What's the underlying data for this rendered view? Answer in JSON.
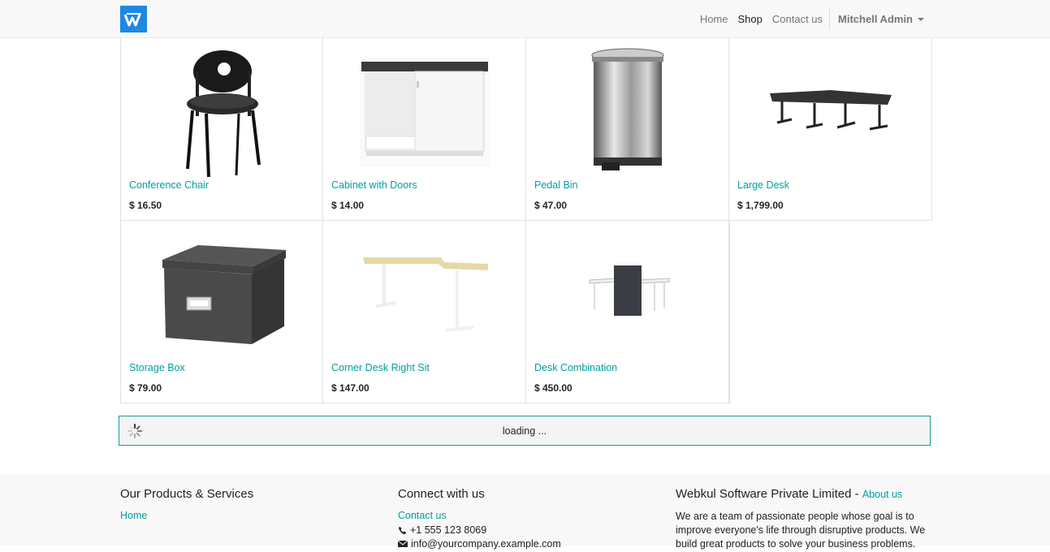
{
  "nav": {
    "links": [
      "Home",
      "Shop",
      "Contact us"
    ],
    "active": "Shop",
    "user": "Mitchell Admin"
  },
  "products": [
    {
      "name": "Conference Chair",
      "price": "$ 16.50",
      "icon": "chair-image"
    },
    {
      "name": "Cabinet with Doors",
      "price": "$ 14.00",
      "icon": "cabinet-image"
    },
    {
      "name": "Pedal Bin",
      "price": "$ 47.00",
      "icon": "bin-image"
    },
    {
      "name": "Large Desk",
      "price": "$ 1,799.00",
      "icon": "desk-image"
    },
    {
      "name": "Storage Box",
      "price": "$ 79.00",
      "icon": "box-image"
    },
    {
      "name": "Corner Desk Right Sit",
      "price": "$ 147.00",
      "icon": "corner-desk-image"
    },
    {
      "name": "Desk Combination",
      "price": "$ 450.00",
      "icon": "desk-combination-image"
    }
  ],
  "loading": {
    "text": "loading ..."
  },
  "footer": {
    "col1": {
      "title": "Our Products & Services",
      "link": "Home"
    },
    "col2": {
      "title": "Connect with us",
      "link": "Contact us",
      "phone": "+1 555 123 8069",
      "email": "info@yourcompany.example.com"
    },
    "col3": {
      "title": "Webkul Software Private Limited",
      "title_sep": " - ",
      "about": "About us",
      "text": "We are a team of passionate people whose goal is to improve everyone's life through disruptive products. We build great products to solve your business problems."
    }
  },
  "colors": {
    "accent": "#00A09D",
    "logo": "#1e88e5"
  }
}
